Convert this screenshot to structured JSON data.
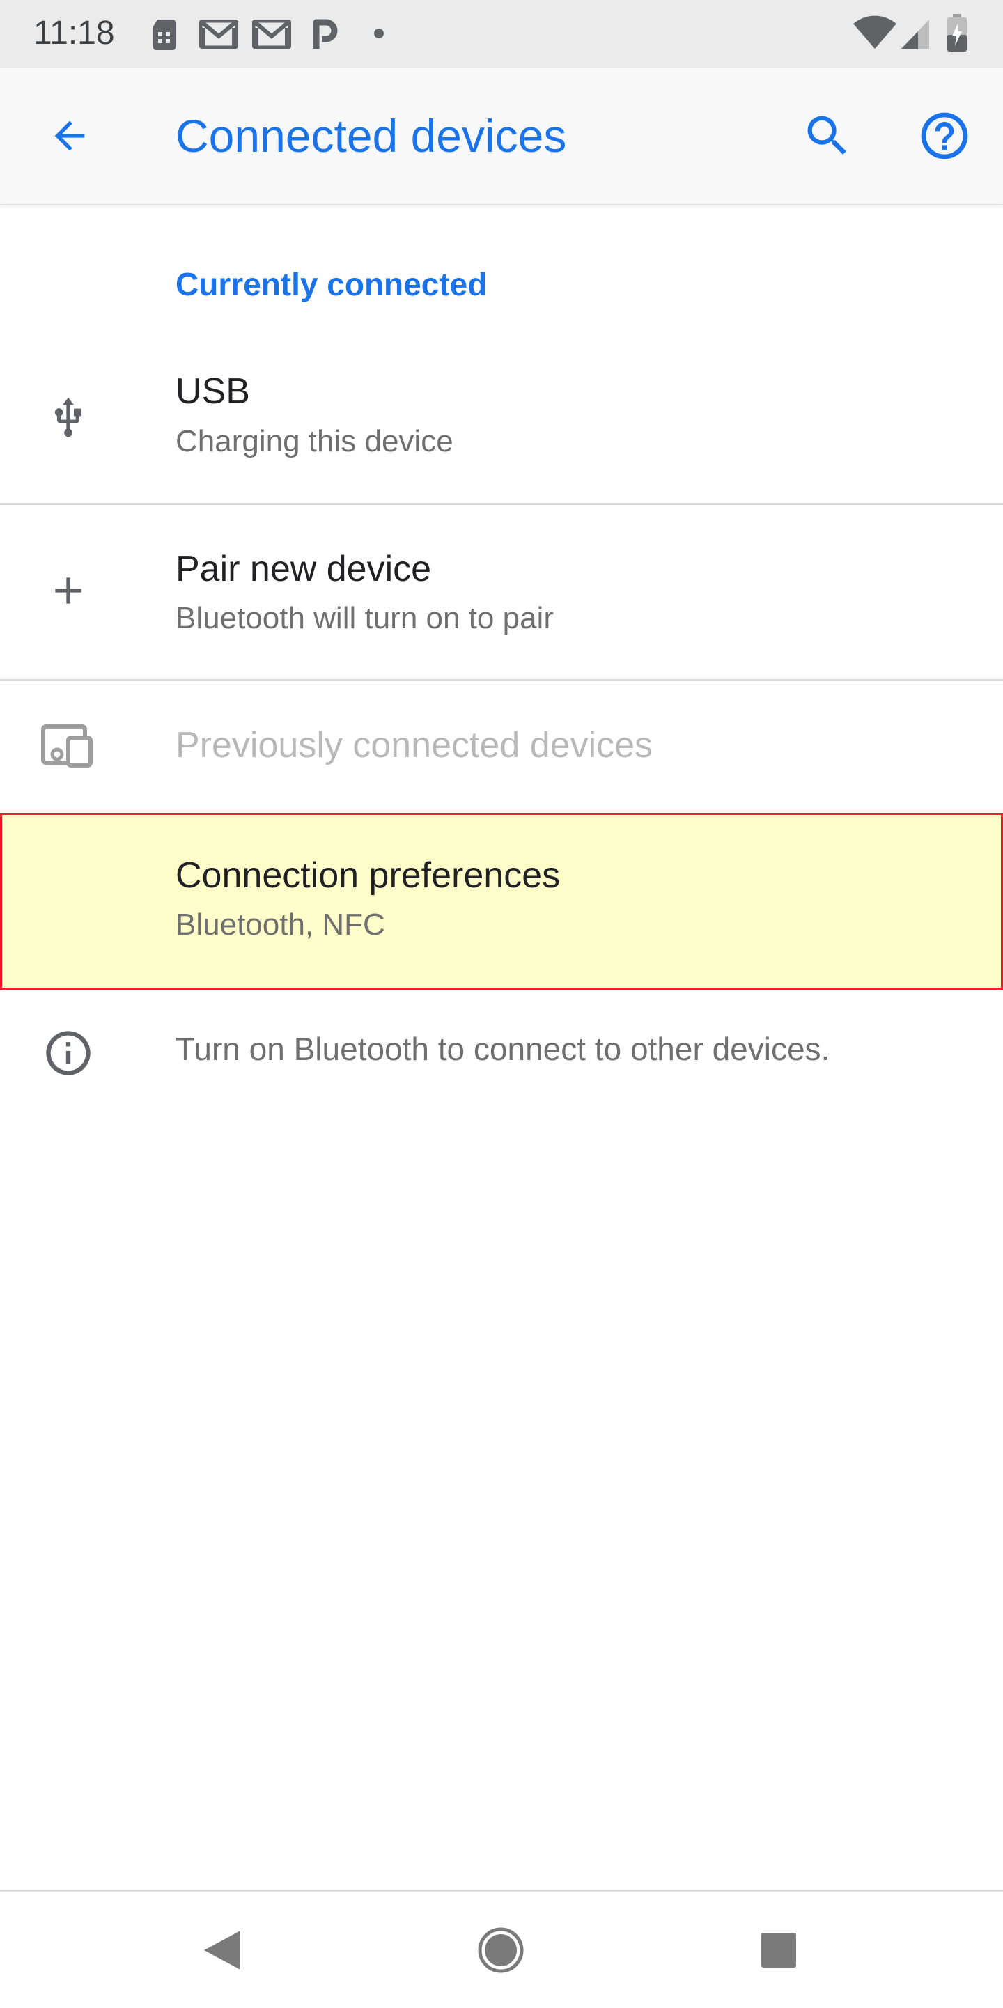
{
  "status_bar": {
    "time": "11:18",
    "left_icons": [
      "sim-card-icon",
      "gmail-icon",
      "gmail-icon",
      "pocket-p-icon",
      "dot-icon"
    ],
    "right_icons": [
      "wifi-icon",
      "cell-signal-icon",
      "battery-charging-icon"
    ]
  },
  "app_bar": {
    "title": "Connected devices",
    "back_icon": "arrow-back-icon",
    "search_icon": "search-icon",
    "help_icon": "help-icon"
  },
  "list": {
    "section_header": "Currently connected",
    "usb": {
      "icon": "usb-icon",
      "title": "USB",
      "subtitle": "Charging this device"
    },
    "pair": {
      "icon": "plus-icon",
      "title": "Pair new device",
      "subtitle": "Bluetooth will turn on to pair"
    },
    "previous": {
      "icon": "devices-icon",
      "title": "Previously connected devices"
    },
    "preferences": {
      "title": "Connection preferences",
      "subtitle": "Bluetooth, NFC"
    }
  },
  "info": {
    "icon": "info-icon",
    "text": "Turn on Bluetooth to connect to other devices."
  },
  "nav_bar": {
    "back": "nav-back-icon",
    "home": "nav-home-icon",
    "recents": "nav-recents-icon"
  },
  "colors": {
    "accent": "#1a73e8",
    "highlight_fill": "#fefdca",
    "highlight_border": "#e8202c",
    "status_bar_bg": "#ebebeb",
    "app_bar_bg": "#f7f8fa"
  }
}
